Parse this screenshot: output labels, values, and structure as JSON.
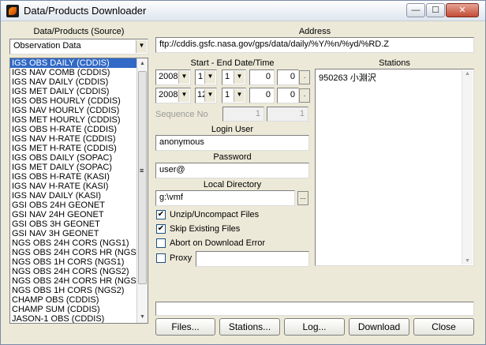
{
  "window": {
    "title": "Data/Products Downloader"
  },
  "titlebar": {
    "minimize": "—",
    "maximize": "☐",
    "close": "✕"
  },
  "left": {
    "heading": "Data/Products (Source)",
    "source_selected": "Observation Data",
    "items": [
      "IGS OBS DAILY (CDDIS)",
      "IGS NAV COMB  (CDDIS)",
      "IGS NAV DAILY (CDDIS)",
      "IGS MET DAILY (CDDIS)",
      "IGS OBS HOURLY (CDDIS)",
      "IGS NAV HOURLY (CDDIS)",
      "IGS MET HOURLY (CDDIS)",
      "IGS OBS H-RATE (CDDIS)",
      "IGS NAV H-RATE (CDDIS)",
      "IGS MET H-RATE (CDDIS)",
      "IGS OBS DAILY (SOPAC)",
      "IGS MET DAILY (SOPAC)",
      "IGS OBS H-RATE (KASI)",
      "IGS NAV H-RATE (KASI)",
      "IGS NAV DAILY (KASI)",
      "GSI OBS 24H GEONET",
      "GSI NAV 24H GEONET",
      "GSI OBS  3H GEONET",
      "GSI NAV  3H GEONET",
      "NGS OBS 24H CORS (NGS1)",
      "NGS OBS 24H CORS HR (NGS",
      "NGS OBS  1H CORS (NGS1)",
      "NGS OBS 24H CORS (NGS2)",
      "NGS OBS 24H CORS HR (NGS",
      "NGS OBS  1H CORS (NGS2)",
      "CHAMP OBS (CDDIS)",
      "CHAMP SUM (CDDIS)",
      "JASON-1 OBS (CDDIS)"
    ]
  },
  "address": {
    "label": "Address",
    "value": "ftp://cddis.gsfc.nasa.gov/gps/data/daily/%Y/%n/%yd/%RD.Z"
  },
  "dates": {
    "label": "Start - End Date/Time",
    "start": {
      "year": "2008",
      "month": "1",
      "day": "1",
      "hour": "0",
      "min": "0"
    },
    "end": {
      "year": "2008",
      "month": "12",
      "day": "1",
      "hour": "0",
      "min": "0"
    },
    "dots": "."
  },
  "sequence": {
    "label": "Sequence No",
    "from": "1",
    "to": "1"
  },
  "login": {
    "label": "Login User",
    "value": "anonymous"
  },
  "password": {
    "label": "Password",
    "value": "user@"
  },
  "local_dir": {
    "label": "Local Directory",
    "value": "g:\\vmf",
    "browse": "..."
  },
  "options": {
    "unzip": "Unzip/Uncompact Files",
    "skip": "Skip Existing Files",
    "abort": "Abort on Download Error",
    "proxy": "Proxy",
    "unzip_checked": true,
    "skip_checked": true,
    "abort_checked": false,
    "proxy_checked": false
  },
  "stations": {
    "label": "Stations",
    "value": "950263 小淵沢"
  },
  "buttons": {
    "files": "Files...",
    "stations": "Stations...",
    "log": "Log...",
    "download": "Download",
    "close": "Close"
  },
  "icons": {
    "check": "✔",
    "arrow_down": "▼",
    "arrow_up": "▲",
    "grip": "≡"
  }
}
